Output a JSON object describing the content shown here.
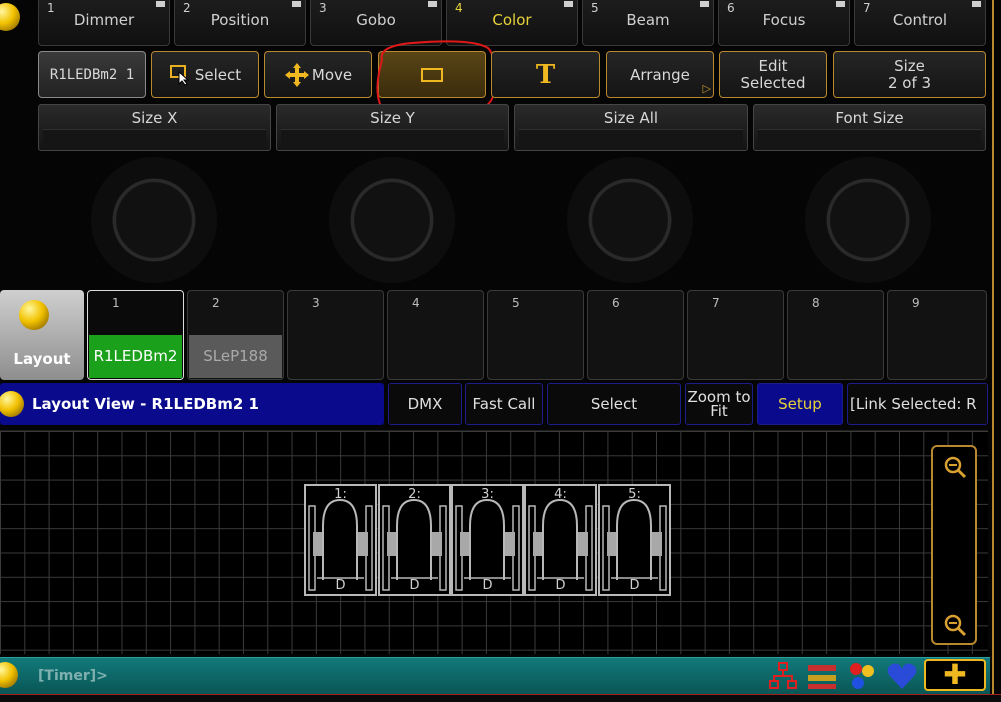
{
  "presets": [
    {
      "num": "1",
      "label": "Dimmer"
    },
    {
      "num": "2",
      "label": "Position"
    },
    {
      "num": "3",
      "label": "Gobo"
    },
    {
      "num": "4",
      "label": "Color"
    },
    {
      "num": "5",
      "label": "Beam"
    },
    {
      "num": "6",
      "label": "Focus"
    },
    {
      "num": "7",
      "label": "Control"
    }
  ],
  "toolbar": {
    "view_name": "R1LEDBm2 1",
    "select": "Select",
    "move": "Move",
    "text_icon": "T",
    "arrange": "Arrange",
    "edit_line1": "Edit",
    "edit_line2": "Selected",
    "size_line1": "Size",
    "size_line2": "2 of 3"
  },
  "encoders": [
    "Size X",
    "Size Y",
    "Size All",
    "Font Size"
  ],
  "pool": {
    "label": "Layout",
    "slots": [
      {
        "num": "1",
        "name": "R1LEDBm2"
      },
      {
        "num": "2",
        "name": "SLeP188"
      },
      {
        "num": "3",
        "name": ""
      },
      {
        "num": "4",
        "name": ""
      },
      {
        "num": "5",
        "name": ""
      },
      {
        "num": "6",
        "name": ""
      },
      {
        "num": "7",
        "name": ""
      },
      {
        "num": "8",
        "name": ""
      },
      {
        "num": "9",
        "name": ""
      }
    ]
  },
  "layout_view": {
    "title": "Layout View - R1LEDBm2 1",
    "dmx": "DMX",
    "fast_call": "Fast Call",
    "select": "Select",
    "zoom_line1": "Zoom to",
    "zoom_line2": "Fit",
    "setup": "Setup",
    "link": "[Link Selected: R"
  },
  "fixtures": [
    {
      "label": "1:",
      "bottom": "D"
    },
    {
      "label": "2:",
      "bottom": "D"
    },
    {
      "label": "3:",
      "bottom": "D"
    },
    {
      "label": "4:",
      "bottom": "D"
    },
    {
      "label": "5:",
      "bottom": "D"
    }
  ],
  "command_line": {
    "prompt": "[Timer]>"
  },
  "colors": {
    "accent_gold": "#b8892e",
    "active_yellow": "#e8d23a",
    "title_blue": "#0a0a8c",
    "cmd_teal": "#0e6b6b",
    "pool_green": "#1aa01a"
  }
}
